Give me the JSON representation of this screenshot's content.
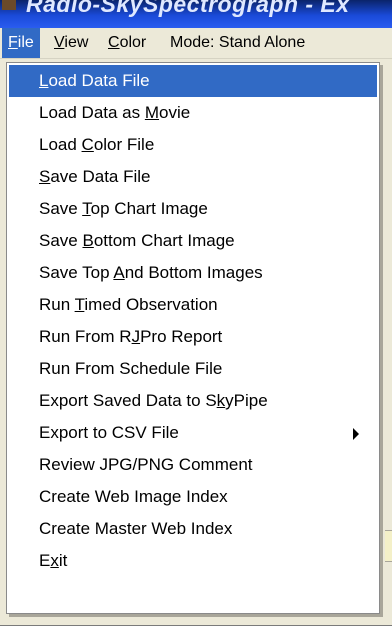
{
  "window": {
    "title": "Radio-SkySpectrograph - Ex"
  },
  "menubar": {
    "items": [
      {
        "label_ul": "F",
        "label_rest": "ile"
      },
      {
        "label_ul": "V",
        "label_rest": "iew"
      },
      {
        "label_ul": "C",
        "label_rest": "olor"
      },
      {
        "label_plain": "Mode: Stand Alone"
      }
    ]
  },
  "file_menu": {
    "items": [
      {
        "pre": "",
        "ul": "L",
        "post": "oad Data File"
      },
      {
        "pre": "Load Data as ",
        "ul": "M",
        "post": "ovie"
      },
      {
        "pre": "Load ",
        "ul": "C",
        "post": "olor File"
      },
      {
        "pre": "",
        "ul": "S",
        "post": "ave Data File"
      },
      {
        "pre": "Save ",
        "ul": "T",
        "post": "op Chart Image"
      },
      {
        "pre": "Save ",
        "ul": "B",
        "post": "ottom Chart Image"
      },
      {
        "pre": "Save Top ",
        "ul": "A",
        "post": "nd Bottom Images"
      },
      {
        "pre": "Run ",
        "ul": "T",
        "post": "imed Observation"
      },
      {
        "pre": "Run From R",
        "ul": "J",
        "post": "Pro Report"
      },
      {
        "pre": "Run From Schedule File",
        "ul": "",
        "post": ""
      },
      {
        "pre": "Export Saved Data to S",
        "ul": "k",
        "post": "yPipe"
      },
      {
        "pre": "Export to CSV File",
        "ul": "",
        "post": ""
      },
      {
        "pre": "Review JPG/PNG Comment",
        "ul": "",
        "post": ""
      },
      {
        "pre": "Create Web Image Index",
        "ul": "",
        "post": ""
      },
      {
        "pre": "Create Master Web Index",
        "ul": "",
        "post": ""
      },
      {
        "pre": "E",
        "ul": "x",
        "post": "it"
      }
    ]
  },
  "icons": {
    "submenu_arrow": "chevron-right-icon"
  }
}
